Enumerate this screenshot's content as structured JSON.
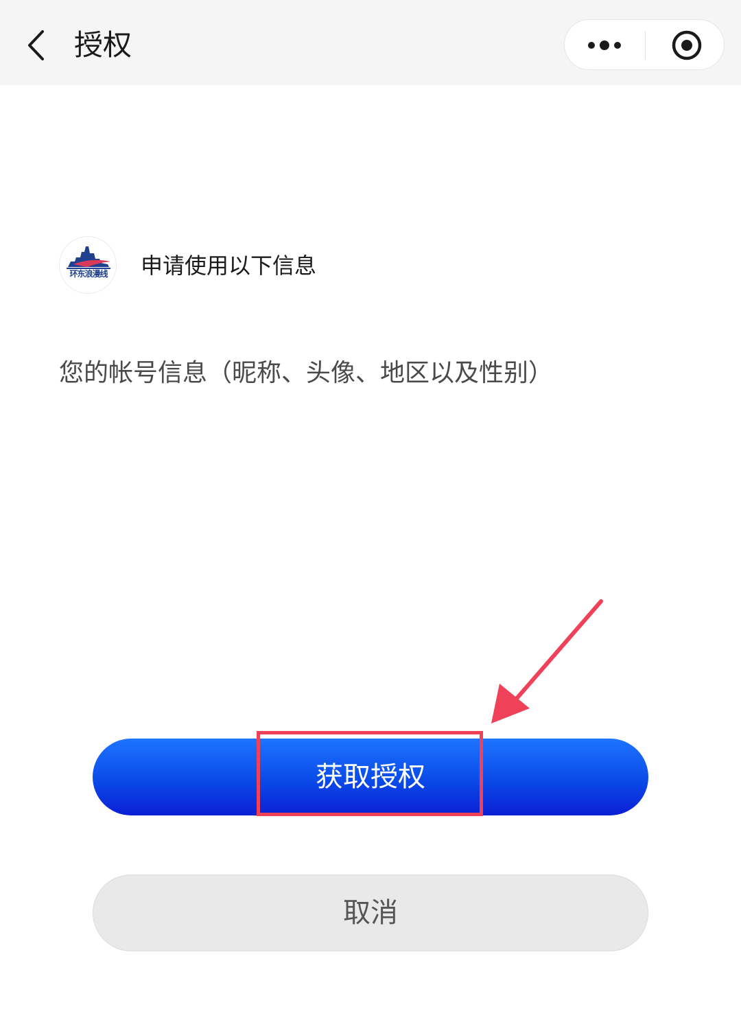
{
  "navbar": {
    "title": "授权",
    "back_icon": "chevron-left-icon",
    "menu_icon": "more-dots-icon",
    "close_icon": "target-close-icon"
  },
  "app": {
    "logo_text": "环东浪漫线",
    "request_title": "申请使用以下信息"
  },
  "permission": {
    "info_text": "您的帐号信息（昵称、头像、地区以及性别）"
  },
  "buttons": {
    "authorize_label": "获取授权",
    "cancel_label": "取消"
  },
  "annotation": {
    "highlight_color": "#ef4158"
  },
  "colors": {
    "primary": "#0a4ae8",
    "navbar_bg": "#f5f5f5",
    "cancel_bg": "#e9e9e9"
  }
}
